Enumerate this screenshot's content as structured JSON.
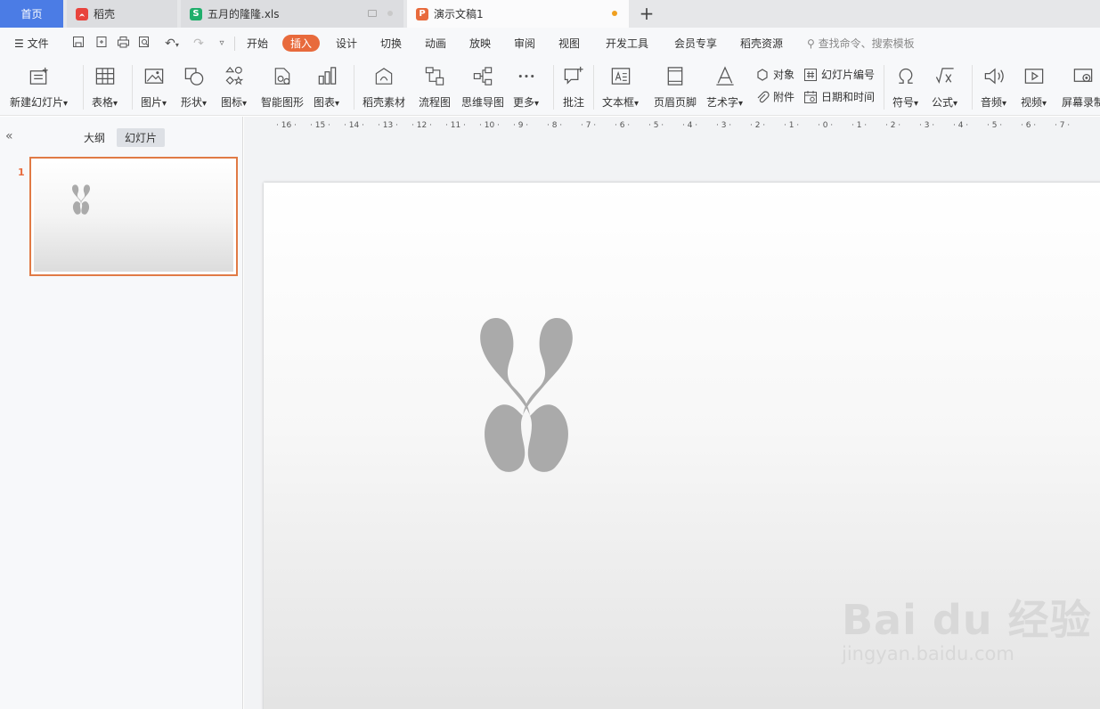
{
  "tabs": {
    "home": "首页",
    "docer": "稻壳",
    "sheet": "五月的隆隆.xls",
    "active": "演示文稿1"
  },
  "menu": {
    "file": "文件",
    "items": [
      "开始",
      "插入",
      "设计",
      "切换",
      "动画",
      "放映",
      "审阅",
      "视图",
      "开发工具",
      "会员专享",
      "稻壳资源"
    ],
    "active": "插入",
    "search_placeholder": "查找命令、搜索模板"
  },
  "ribbon": {
    "new_slide": "新建幻灯片",
    "table": "表格",
    "picture": "图片",
    "shape": "形状",
    "icon": "图标",
    "smartart": "智能图形",
    "chart": "图表",
    "docer_material": "稻壳素材",
    "flowchart": "流程图",
    "mindmap": "思维导图",
    "more": "更多",
    "comment": "批注",
    "textbox": "文本框",
    "header_footer": "页眉页脚",
    "wordart": "艺术字",
    "object": "对象",
    "attachment": "附件",
    "slide_number": "幻灯片编号",
    "datetime": "日期和时间",
    "symbol": "符号",
    "formula": "公式",
    "audio": "音频",
    "video": "视频",
    "screen_record": "屏幕录制"
  },
  "panel": {
    "outline": "大纲",
    "slides": "幻灯片",
    "slide_number": "1"
  },
  "ruler": [
    "16",
    "15",
    "14",
    "13",
    "12",
    "11",
    "10",
    "9",
    "8",
    "7",
    "6",
    "5",
    "4",
    "3",
    "2",
    "1",
    "0",
    "1",
    "2",
    "3",
    "4",
    "5",
    "6",
    "7"
  ],
  "watermark": {
    "brand": "Bai du 经验",
    "url": "jingyan.baidu.com"
  },
  "colors": {
    "accent": "#e86a3c",
    "home_tab": "#4b7ce5",
    "sheet_icon": "#1fae6b",
    "ppt_icon": "#e86a3c",
    "docer_icon": "#e8433c"
  }
}
